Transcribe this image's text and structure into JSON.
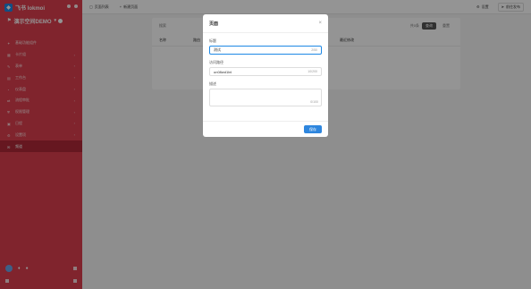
{
  "sidebar": {
    "app_title": "飞书 lokmoi",
    "workspace": "演示空间DEMO",
    "items": [
      {
        "icon": "puzzle-icon",
        "label": "基础功能组件"
      },
      {
        "icon": "grid-icon",
        "label": "卡片组"
      },
      {
        "icon": "edit-icon",
        "label": "表单"
      },
      {
        "icon": "doc-icon",
        "label": "工作台"
      },
      {
        "icon": "chart-icon",
        "label": "仪表盘"
      },
      {
        "icon": "flow-icon",
        "label": "流程审批"
      },
      {
        "icon": "shield-icon",
        "label": "权限管理"
      },
      {
        "icon": "calendar-icon",
        "label": "日程"
      },
      {
        "icon": "gear-icon",
        "label": "设置项"
      },
      {
        "icon": "chat-icon",
        "label": "频道"
      }
    ]
  },
  "topbar": {
    "tab1": "页面列表",
    "tab2": "新建页面",
    "right1": "设置",
    "right2": "前往发布"
  },
  "panel": {
    "search": "搜索",
    "page_hint": "共0条",
    "btn_search": "查询",
    "btn_reset": "重置",
    "columns": [
      "名称",
      "路由",
      "描述",
      "创建时间",
      "操作人",
      "最近修改"
    ]
  },
  "modal": {
    "title": "页面",
    "close": "×",
    "fields": {
      "title_label": "标题",
      "title_value": "测试",
      "title_count": "2/50",
      "route_label": "访问路径",
      "route_value": "un08wd1lnl",
      "route_count": "10/200",
      "desc_label": "描述",
      "desc_count": "0/100"
    },
    "save": "保存"
  }
}
